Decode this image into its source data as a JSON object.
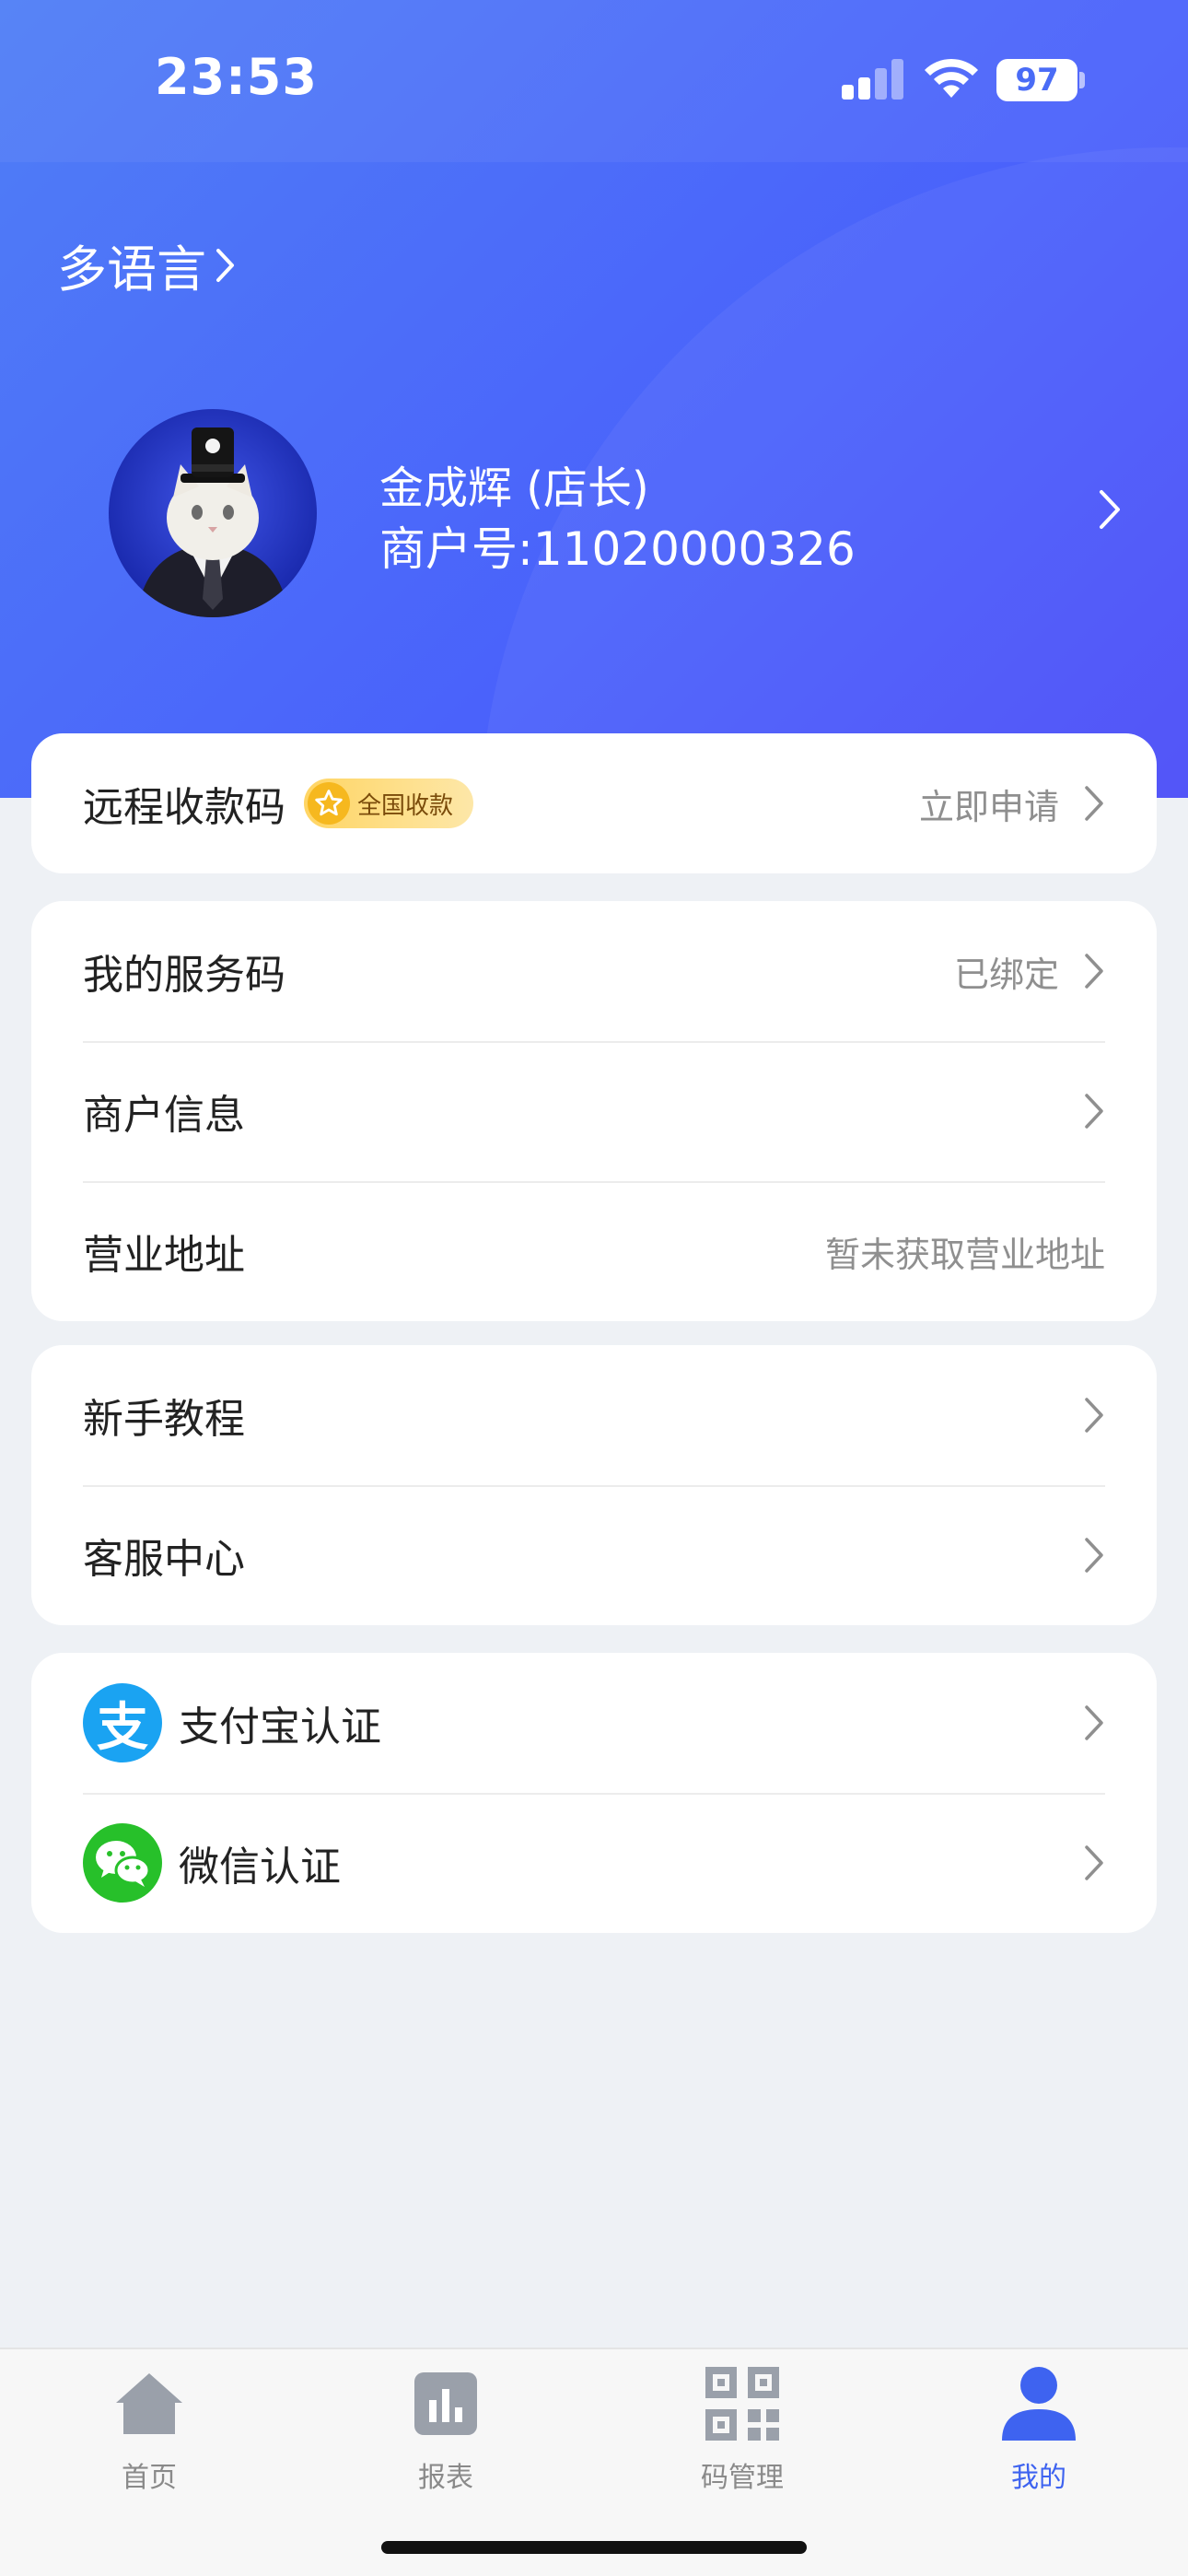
{
  "status_bar": {
    "time": "23:53",
    "battery": "97"
  },
  "header": {
    "language_label": "多语言",
    "user_name": "金成辉 (店长)",
    "merchant_id": "商户号:11020000326"
  },
  "remote_payment": {
    "label": "远程收款码",
    "badge": "全国收款",
    "action": "立即申请"
  },
  "merchant_section": {
    "service_code": {
      "label": "我的服务码",
      "status": "已绑定"
    },
    "merchant_info": {
      "label": "商户信息"
    },
    "business_address": {
      "label": "营业地址",
      "value": "暂未获取营业地址"
    }
  },
  "help_section": {
    "tutorial": {
      "label": "新手教程"
    },
    "customer_service": {
      "label": "客服中心"
    }
  },
  "auth_section": {
    "alipay": {
      "label": "支付宝认证",
      "icon_char": "支"
    },
    "wechat": {
      "label": "微信认证"
    }
  },
  "tabbar": {
    "items": [
      {
        "label": "首页",
        "icon": "home-icon"
      },
      {
        "label": "报表",
        "icon": "chart-icon"
      },
      {
        "label": "码管理",
        "icon": "qr-code-icon"
      },
      {
        "label": "我的",
        "icon": "user-icon"
      }
    ],
    "active_index": 3
  },
  "colors": {
    "accent": "#3e63f0",
    "header_gradient_start": "#4f7ef6",
    "header_gradient_end": "#4a4cf8",
    "alipay_blue": "#1aa3f2",
    "wechat_green": "#27c02a",
    "badge_gold": "#ffd564"
  }
}
